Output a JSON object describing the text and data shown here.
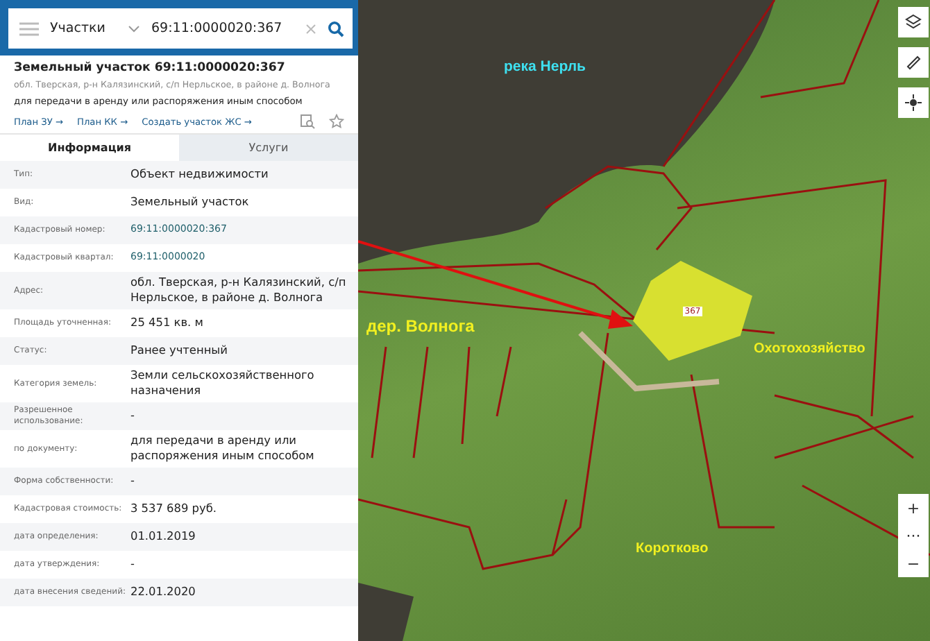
{
  "search": {
    "category": "Участки",
    "value": "69:11:0000020:367"
  },
  "parcel": {
    "title": "Земельный участок 69:11:0000020:367",
    "address": "обл. Тверская, р-н Калязинский, с/п Нерльское, в районе д. Волнога",
    "purpose": "для передачи в аренду или распоряжения иным способом",
    "links": [
      "План ЗУ →",
      "План КК →",
      "Создать участок ЖС →"
    ]
  },
  "tabs": [
    {
      "label": "Информация",
      "selected": true
    },
    {
      "label": "Услуги",
      "selected": false
    }
  ],
  "fields": [
    {
      "label": "Тип:",
      "value": "Объект недвижимости",
      "kind": "text"
    },
    {
      "label": "Вид:",
      "value": "Земельный участок",
      "kind": "text"
    },
    {
      "label": "Кадастровый номер:",
      "value": "69:11:0000020:367",
      "kind": "link"
    },
    {
      "label": "Кадастровый квартал:",
      "value": "69:11:0000020",
      "kind": "link"
    },
    {
      "label": "Адрес:",
      "value": "обл. Тверская, р-н Калязинский, с/п Нерльское, в районе д. Волнога",
      "kind": "text"
    },
    {
      "label": "Площадь уточненная:",
      "value": "25 451 кв. м",
      "kind": "text"
    },
    {
      "label": "Статус:",
      "value": "Ранее учтенный",
      "kind": "text"
    },
    {
      "label": "Категория земель:",
      "value": "Земли сельскохозяйственного назначения",
      "kind": "text"
    },
    {
      "label": "Разрешенное использование:",
      "value": "-",
      "kind": "text"
    },
    {
      "label": "по документу:",
      "value": "для передачи в аренду или распоряжения иным способом",
      "kind": "text"
    },
    {
      "label": "Форма собственности:",
      "value": "-",
      "kind": "text"
    },
    {
      "label": "Кадастровая стоимость:",
      "value": "3 537 689 руб.",
      "kind": "text"
    },
    {
      "label": "дата определения:",
      "value": "01.01.2019",
      "kind": "text"
    },
    {
      "label": "дата утверждения:",
      "value": "-",
      "kind": "text"
    },
    {
      "label": "дата внесения сведений:",
      "value": "22.01.2020",
      "kind": "text"
    }
  ],
  "map": {
    "labels": [
      {
        "text": "река Нерль",
        "kind": "water"
      },
      {
        "text": "дер. Волнога",
        "kind": "place"
      },
      {
        "text": "Охотохозяйство",
        "kind": "place"
      },
      {
        "text": "Коротково",
        "kind": "place"
      }
    ],
    "parcel_label": "367",
    "zoom_controls": [
      "+",
      "···",
      "−"
    ]
  }
}
